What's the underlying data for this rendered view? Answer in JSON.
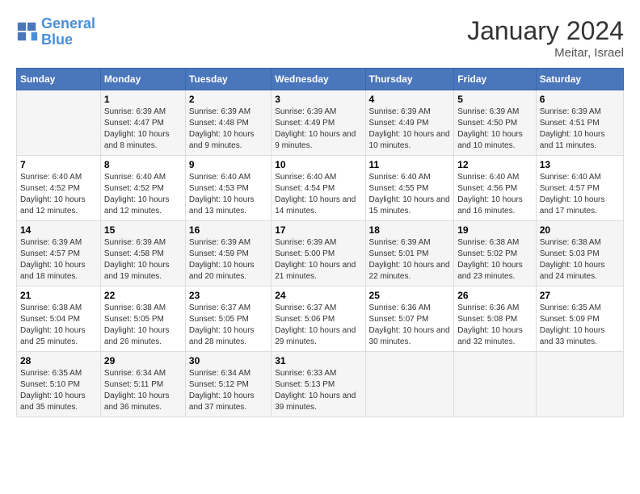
{
  "header": {
    "logo_line1": "General",
    "logo_line2": "Blue",
    "month": "January 2024",
    "location": "Meitar, Israel"
  },
  "weekdays": [
    "Sunday",
    "Monday",
    "Tuesday",
    "Wednesday",
    "Thursday",
    "Friday",
    "Saturday"
  ],
  "weeks": [
    [
      {
        "day": "",
        "sunrise": "",
        "sunset": "",
        "daylight": ""
      },
      {
        "day": "1",
        "sunrise": "Sunrise: 6:39 AM",
        "sunset": "Sunset: 4:47 PM",
        "daylight": "Daylight: 10 hours and 8 minutes."
      },
      {
        "day": "2",
        "sunrise": "Sunrise: 6:39 AM",
        "sunset": "Sunset: 4:48 PM",
        "daylight": "Daylight: 10 hours and 9 minutes."
      },
      {
        "day": "3",
        "sunrise": "Sunrise: 6:39 AM",
        "sunset": "Sunset: 4:49 PM",
        "daylight": "Daylight: 10 hours and 9 minutes."
      },
      {
        "day": "4",
        "sunrise": "Sunrise: 6:39 AM",
        "sunset": "Sunset: 4:49 PM",
        "daylight": "Daylight: 10 hours and 10 minutes."
      },
      {
        "day": "5",
        "sunrise": "Sunrise: 6:39 AM",
        "sunset": "Sunset: 4:50 PM",
        "daylight": "Daylight: 10 hours and 10 minutes."
      },
      {
        "day": "6",
        "sunrise": "Sunrise: 6:39 AM",
        "sunset": "Sunset: 4:51 PM",
        "daylight": "Daylight: 10 hours and 11 minutes."
      }
    ],
    [
      {
        "day": "7",
        "sunrise": "Sunrise: 6:40 AM",
        "sunset": "Sunset: 4:52 PM",
        "daylight": "Daylight: 10 hours and 12 minutes."
      },
      {
        "day": "8",
        "sunrise": "Sunrise: 6:40 AM",
        "sunset": "Sunset: 4:52 PM",
        "daylight": "Daylight: 10 hours and 12 minutes."
      },
      {
        "day": "9",
        "sunrise": "Sunrise: 6:40 AM",
        "sunset": "Sunset: 4:53 PM",
        "daylight": "Daylight: 10 hours and 13 minutes."
      },
      {
        "day": "10",
        "sunrise": "Sunrise: 6:40 AM",
        "sunset": "Sunset: 4:54 PM",
        "daylight": "Daylight: 10 hours and 14 minutes."
      },
      {
        "day": "11",
        "sunrise": "Sunrise: 6:40 AM",
        "sunset": "Sunset: 4:55 PM",
        "daylight": "Daylight: 10 hours and 15 minutes."
      },
      {
        "day": "12",
        "sunrise": "Sunrise: 6:40 AM",
        "sunset": "Sunset: 4:56 PM",
        "daylight": "Daylight: 10 hours and 16 minutes."
      },
      {
        "day": "13",
        "sunrise": "Sunrise: 6:40 AM",
        "sunset": "Sunset: 4:57 PM",
        "daylight": "Daylight: 10 hours and 17 minutes."
      }
    ],
    [
      {
        "day": "14",
        "sunrise": "Sunrise: 6:39 AM",
        "sunset": "Sunset: 4:57 PM",
        "daylight": "Daylight: 10 hours and 18 minutes."
      },
      {
        "day": "15",
        "sunrise": "Sunrise: 6:39 AM",
        "sunset": "Sunset: 4:58 PM",
        "daylight": "Daylight: 10 hours and 19 minutes."
      },
      {
        "day": "16",
        "sunrise": "Sunrise: 6:39 AM",
        "sunset": "Sunset: 4:59 PM",
        "daylight": "Daylight: 10 hours and 20 minutes."
      },
      {
        "day": "17",
        "sunrise": "Sunrise: 6:39 AM",
        "sunset": "Sunset: 5:00 PM",
        "daylight": "Daylight: 10 hours and 21 minutes."
      },
      {
        "day": "18",
        "sunrise": "Sunrise: 6:39 AM",
        "sunset": "Sunset: 5:01 PM",
        "daylight": "Daylight: 10 hours and 22 minutes."
      },
      {
        "day": "19",
        "sunrise": "Sunrise: 6:38 AM",
        "sunset": "Sunset: 5:02 PM",
        "daylight": "Daylight: 10 hours and 23 minutes."
      },
      {
        "day": "20",
        "sunrise": "Sunrise: 6:38 AM",
        "sunset": "Sunset: 5:03 PM",
        "daylight": "Daylight: 10 hours and 24 minutes."
      }
    ],
    [
      {
        "day": "21",
        "sunrise": "Sunrise: 6:38 AM",
        "sunset": "Sunset: 5:04 PM",
        "daylight": "Daylight: 10 hours and 25 minutes."
      },
      {
        "day": "22",
        "sunrise": "Sunrise: 6:38 AM",
        "sunset": "Sunset: 5:05 PM",
        "daylight": "Daylight: 10 hours and 26 minutes."
      },
      {
        "day": "23",
        "sunrise": "Sunrise: 6:37 AM",
        "sunset": "Sunset: 5:05 PM",
        "daylight": "Daylight: 10 hours and 28 minutes."
      },
      {
        "day": "24",
        "sunrise": "Sunrise: 6:37 AM",
        "sunset": "Sunset: 5:06 PM",
        "daylight": "Daylight: 10 hours and 29 minutes."
      },
      {
        "day": "25",
        "sunrise": "Sunrise: 6:36 AM",
        "sunset": "Sunset: 5:07 PM",
        "daylight": "Daylight: 10 hours and 30 minutes."
      },
      {
        "day": "26",
        "sunrise": "Sunrise: 6:36 AM",
        "sunset": "Sunset: 5:08 PM",
        "daylight": "Daylight: 10 hours and 32 minutes."
      },
      {
        "day": "27",
        "sunrise": "Sunrise: 6:35 AM",
        "sunset": "Sunset: 5:09 PM",
        "daylight": "Daylight: 10 hours and 33 minutes."
      }
    ],
    [
      {
        "day": "28",
        "sunrise": "Sunrise: 6:35 AM",
        "sunset": "Sunset: 5:10 PM",
        "daylight": "Daylight: 10 hours and 35 minutes."
      },
      {
        "day": "29",
        "sunrise": "Sunrise: 6:34 AM",
        "sunset": "Sunset: 5:11 PM",
        "daylight": "Daylight: 10 hours and 36 minutes."
      },
      {
        "day": "30",
        "sunrise": "Sunrise: 6:34 AM",
        "sunset": "Sunset: 5:12 PM",
        "daylight": "Daylight: 10 hours and 37 minutes."
      },
      {
        "day": "31",
        "sunrise": "Sunrise: 6:33 AM",
        "sunset": "Sunset: 5:13 PM",
        "daylight": "Daylight: 10 hours and 39 minutes."
      },
      {
        "day": "",
        "sunrise": "",
        "sunset": "",
        "daylight": ""
      },
      {
        "day": "",
        "sunrise": "",
        "sunset": "",
        "daylight": ""
      },
      {
        "day": "",
        "sunrise": "",
        "sunset": "",
        "daylight": ""
      }
    ]
  ]
}
